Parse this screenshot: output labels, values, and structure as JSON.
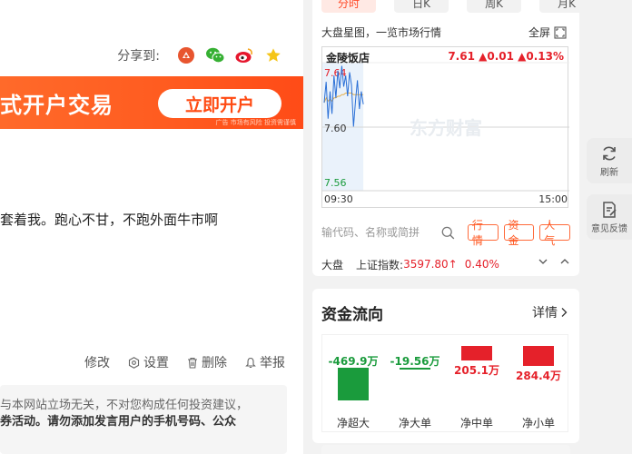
{
  "share": {
    "label": "分享到:",
    "icons": [
      "weibo-tencent-icon",
      "wechat-icon",
      "sina-weibo-icon",
      "favorite-star-icon"
    ]
  },
  "banner": {
    "text": "式开户交易",
    "button": "立即开户",
    "note": "广告  市场有风险 投资需谨慎"
  },
  "post": {
    "text": "套着我。跑心不甘，不跑外面牛市啊"
  },
  "actions": {
    "edit": "修改",
    "settings": "设置",
    "delete": "删除",
    "report": "举报"
  },
  "disclaimer": {
    "line1": "与本网站立场无关，不对您构成任何投资建议，",
    "line2": "券活动。请勿添加发言用户的手机号码、公众"
  },
  "market": {
    "tabs": [
      "分时",
      "日K",
      "周K",
      "月K"
    ],
    "active_tab": 0,
    "title": "大盘星图，一览市场行情",
    "fullscreen": "全屏",
    "stock_name": "金陵饭店",
    "quote": "7.61 ▲0.01 ▲0.13%",
    "y_labels": [
      "7.64",
      "7.60",
      "7.56"
    ],
    "x_labels": [
      "09:30",
      "15:00"
    ],
    "watermark": "东方财富",
    "search_placeholder": "输代码、名称或简拼",
    "tags": [
      "行情",
      "资金",
      "人气"
    ],
    "index_label": "大盘",
    "index_name": "上证指数:",
    "index_value": "3597.80↑",
    "index_change": "0.40%",
    "colors": {
      "up": "#e5212a",
      "down": "#1a9b3c",
      "price_line": "#2a6fd6",
      "avg_line": "#e8b04a"
    }
  },
  "chart_data": {
    "type": "line",
    "title": "",
    "ylim": [
      7.56,
      7.64
    ],
    "base_price": 7.6,
    "x": [
      0,
      1,
      2,
      3,
      4,
      5,
      6,
      7,
      8,
      9,
      10,
      11,
      12,
      13,
      14,
      15,
      16,
      17,
      18,
      19,
      20
    ],
    "series": [
      {
        "values": [
          7.615,
          7.628,
          7.605,
          7.622,
          7.608,
          7.632,
          7.618,
          7.635,
          7.624,
          7.638,
          7.625,
          7.632,
          7.619,
          7.634,
          7.626,
          7.6,
          7.616,
          7.629,
          7.611,
          7.622,
          7.614
        ]
      },
      {
        "values": [
          7.615,
          7.618,
          7.616,
          7.617,
          7.616,
          7.618,
          7.618,
          7.619,
          7.619,
          7.62,
          7.62,
          7.621,
          7.621,
          7.621,
          7.621,
          7.62,
          7.62,
          7.62,
          7.62,
          7.62,
          7.62
        ]
      }
    ],
    "x_total": 240
  },
  "flow": {
    "title": "资金流向",
    "detail": "详情",
    "items": [
      {
        "label": "净超大",
        "value": "-469.9万",
        "amount": -469.9
      },
      {
        "label": "净大单",
        "value": "-19.56万",
        "amount": -19.56
      },
      {
        "label": "净中单",
        "value": "205.1万",
        "amount": 205.1
      },
      {
        "label": "净小单",
        "value": "284.4万",
        "amount": 284.4
      }
    ],
    "colors": {
      "positive": "#e5212a",
      "negative": "#1a9b3c"
    }
  },
  "side": {
    "refresh": "刷新",
    "feedback": "意见反馈"
  }
}
